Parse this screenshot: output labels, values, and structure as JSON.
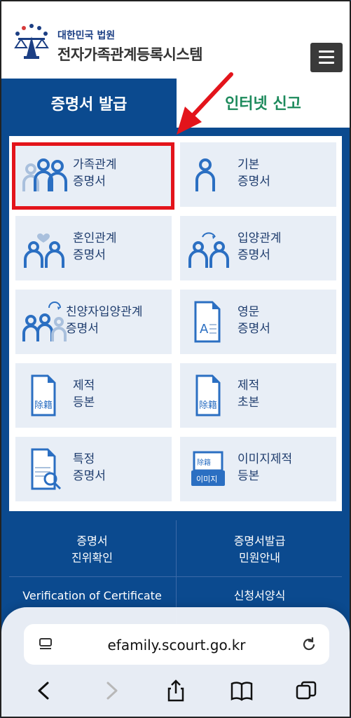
{
  "header": {
    "court_name": "대한민국 법원",
    "system_name": "전자가족관계등록시스템",
    "menu_icon": "hamburger-icon"
  },
  "tabs": [
    {
      "label": "증명서 발급",
      "active": true
    },
    {
      "label": "인터넷 신고",
      "active": false
    }
  ],
  "cards": [
    {
      "line1": "가족관계",
      "line2": "증명서",
      "icon": "family-icon",
      "highlighted": true
    },
    {
      "line1": "기본",
      "line2": "증명서",
      "icon": "person-icon"
    },
    {
      "line1": "혼인관계",
      "line2": "증명서",
      "icon": "couple-heart-icon"
    },
    {
      "line1": "입양관계",
      "line2": "증명서",
      "icon": "couple-arrow-icon"
    },
    {
      "line1": "친양자입양관계",
      "line2": "증명서",
      "icon": "family-arrow-icon"
    },
    {
      "line1": "영문",
      "line2": "증명서",
      "icon": "english-document-icon"
    },
    {
      "line1": "제적",
      "line2": "등본",
      "icon": "removed-register-icon"
    },
    {
      "line1": "제적",
      "line2": "초본",
      "icon": "removed-register-icon"
    },
    {
      "line1": "특정",
      "line2": "증명서",
      "icon": "document-search-icon"
    },
    {
      "line1": "이미지제적",
      "line2": "등본",
      "icon": "image-register-icon"
    }
  ],
  "bottom_links": [
    {
      "line1": "증명서",
      "line2": "진위확인"
    },
    {
      "line1": "증명서발급",
      "line2": "민원안내"
    },
    {
      "line1": "Verification of Certificate",
      "line2": ""
    },
    {
      "line1": "신청서양식",
      "line2": ""
    }
  ],
  "browser": {
    "url": "efamily.scourt.go.kr"
  },
  "colors": {
    "brand_blue": "#0b4a8f",
    "card_bg": "#e8eef6",
    "highlight_red": "#e3141b",
    "tab_green": "#1d8a5c"
  }
}
